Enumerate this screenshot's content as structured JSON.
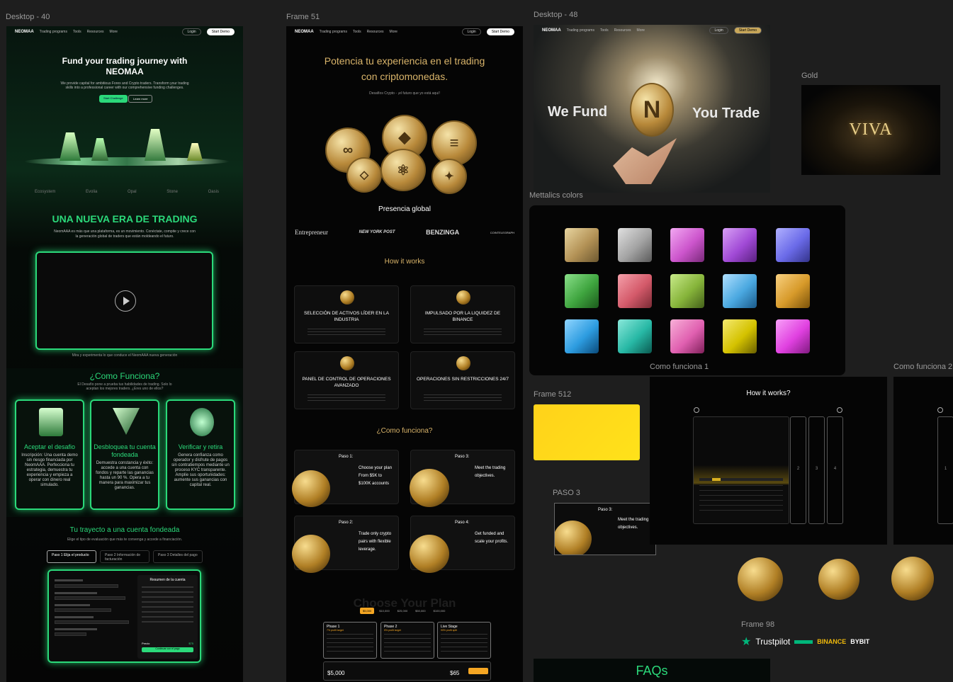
{
  "frames": {
    "desktop40": {
      "label": "Desktop - 40",
      "nav": {
        "logo": "NEOMAA",
        "items": [
          "Trading programs",
          "Tools",
          "Resources",
          "More"
        ],
        "login": "Login",
        "demo": "Start Demo"
      },
      "hero": {
        "title_line1": "Fund your trading journey with",
        "title_line2": "NEOMAA",
        "subtitle": "We provide capital for ambitious Forex and Crypto traders. Transform your trading skills into a professional career with our comprehensive funding challenges.",
        "cta_primary": "Start Challenge",
        "cta_secondary": "Learn more"
      },
      "partners": [
        "Ecosystem",
        "Evolia",
        "Opal",
        "Stone",
        "Oasis"
      ],
      "era": {
        "title": "UNA NUEVA ERA DE TRADING",
        "text": "NeomAAA es más que una plataforma, es un movimiento. Conéctate, compite y crece con la generación global de traders que están moldeando el futuro.",
        "video_caption": "Mira y experimenta lo que conduce el NeomAAA nueva generación"
      },
      "como": {
        "title": "¿Como Funciona?",
        "subtitle": "El Desafío pone a prueba tus habilidades de trading. Solo lo aceptan los mejores traders. ¿Eres uno de ellos?",
        "cards": [
          {
            "title": "Aceptar el desafio",
            "text": "Inscripción: Una cuenta demo sin riesgo financiada por NeomAAA. Perfecciona tu estrategia, demuestra tu experiencia y empieza a operar con dinero real simulado."
          },
          {
            "title": "Desbloquea tu cuenta fondeada",
            "text": "Demuestra constancia y éxito: accede a una cuenta con fondos y reparte las ganancias hasta un 90 %. Opera a tu manera para maximizar tus ganancias."
          },
          {
            "title": "Verificar y retira",
            "text": "Genera confianza como operador y disfrute de pagos sin contratiempos mediante un proceso KYC transparente. Amplíe sus oportunidades: aumente sus ganancias con capital real."
          }
        ]
      },
      "trayecto": {
        "title": "Tu trayecto a una cuenta fondeada",
        "subtitle": "Elige el tipo de evaluación que más te convenga y accede a financiación.",
        "steps": [
          "Paso 1 Elija el producto",
          "Paso 2 Información de facturación",
          "Paso 3 Detalles del pago"
        ],
        "summary_title": "Resumen de la cuenta",
        "price_label": "Precio",
        "price_value": "$75",
        "button": "Continuar con el pago"
      }
    },
    "frame51": {
      "label": "Frame 51",
      "nav": {
        "logo": "NEOMAA",
        "items": [
          "Trading programs",
          "Tools",
          "Resources",
          "More"
        ],
        "login": "Login",
        "demo": "Start Demo"
      },
      "hero": {
        "line1": "Potencia tu experiencia en el trading",
        "line2": "con criptomonedas.",
        "sub": "Desafíos Crypto - ¡el futuro que yo está aquí!"
      },
      "presence": {
        "title": "Presencia global",
        "logos": [
          "Entrepreneur",
          "NEW YORK POST",
          "BENZINGA",
          "COINTELEGRAPH"
        ]
      },
      "how": {
        "title": "How it works",
        "cards": [
          {
            "title": "SELECCIÓN DE ACTIVOS LÍDER EN LA INDUSTRIA"
          },
          {
            "title": "IMPULSADO POR LA LIQUIDEZ DE BINANCE"
          },
          {
            "title": "PANEL DE CONTROL DE OPERACIONES AVANZADO"
          },
          {
            "title": "OPERACIONES SIN RESTRICCIONES 24/7"
          }
        ]
      },
      "como": {
        "title": "¿Como funciona?",
        "steps": [
          {
            "label": "Paso 1:",
            "text": "Choose your plan From $5K to $100K accounts"
          },
          {
            "label": "Paso 3:",
            "text": "Meet the trading objectives."
          },
          {
            "label": "Paso 2:",
            "text": "Trade only crypto pairs with flexible leverage."
          },
          {
            "label": "Paso 4:",
            "text": "Get funded and scale your profits."
          }
        ]
      },
      "plan": {
        "title": "Choose Your Plan",
        "tabs": [
          "$5,000",
          "$10,000",
          "$25,000",
          "$50,000",
          "$100,000"
        ],
        "phases": [
          {
            "name": "Phase 1",
            "sub": "7% profit target"
          },
          {
            "name": "Phase 2",
            "sub": "5% profit target"
          },
          {
            "name": "Live Stage",
            "sub": "90% profit split"
          }
        ],
        "account": "$5,000",
        "price": "$65"
      }
    },
    "desktop48": {
      "label": "Desktop - 48",
      "nav": {
        "logo": "NEOMAA",
        "items": [
          "Trading programs",
          "Tools",
          "Resources",
          "More"
        ],
        "login": "Login",
        "demo": "Start Demo"
      },
      "left": "We Fund",
      "right": "You Trade",
      "coin": "N"
    },
    "gold": {
      "label": "Gold",
      "word": "VIVA"
    },
    "metallics": {
      "label": "Mettalics colors",
      "colors": [
        "#b39256",
        "#a3a3a3",
        "#cc55cc",
        "#a14ad6",
        "#6a6ae8",
        "#3fa53f",
        "#d45a6a",
        "#86b43a",
        "#4aa8e0",
        "#d79a2a",
        "#2d9ce0",
        "#27b8a5",
        "#e060b0",
        "#d4c200",
        "#e040e0"
      ]
    },
    "frame512": {
      "label": "Frame 512"
    },
    "paso3": {
      "label": "PASO 3",
      "step": "Paso 3:",
      "text": "Meet the trading objectives."
    },
    "como1": {
      "label": "Como funciona 1",
      "title": "How it works?",
      "cols": [
        "2",
        "3",
        "4"
      ]
    },
    "como2": {
      "label": "Como funciona 2",
      "col": "1"
    },
    "frame98": {
      "label": "Frame 98",
      "trustpilot": "Trustpilot",
      "binance": "BINANCE",
      "bybit": "BYBIT"
    },
    "faqs": {
      "title": "FAQs"
    }
  }
}
